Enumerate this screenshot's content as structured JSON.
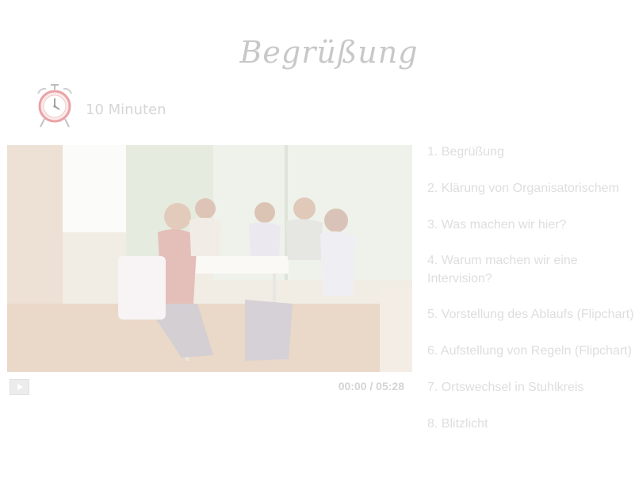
{
  "header": {
    "title": "Begrüßung"
  },
  "timer": {
    "icon": "alarm-clock-icon",
    "label": "10 Minuten"
  },
  "video": {
    "play_icon": "play-icon",
    "time": "00:00 / 05:28"
  },
  "agenda": {
    "items": [
      "1. Begrüßung",
      "2. Klärung von Organisatorischem",
      "3. Was machen wir hier?",
      "4. Warum machen wir eine Intervision?",
      "5. Vorstellung des Ablaufs (Flipchart)",
      "6. Aufstellung von Regeln (Flipchart)",
      "7. Ortswechsel in Stuhlkreis",
      "8. Blitzlicht"
    ]
  },
  "colors": {
    "title": "#c8c8c8",
    "clock": "#e9a3a6",
    "agenda_text": "#dedede"
  }
}
